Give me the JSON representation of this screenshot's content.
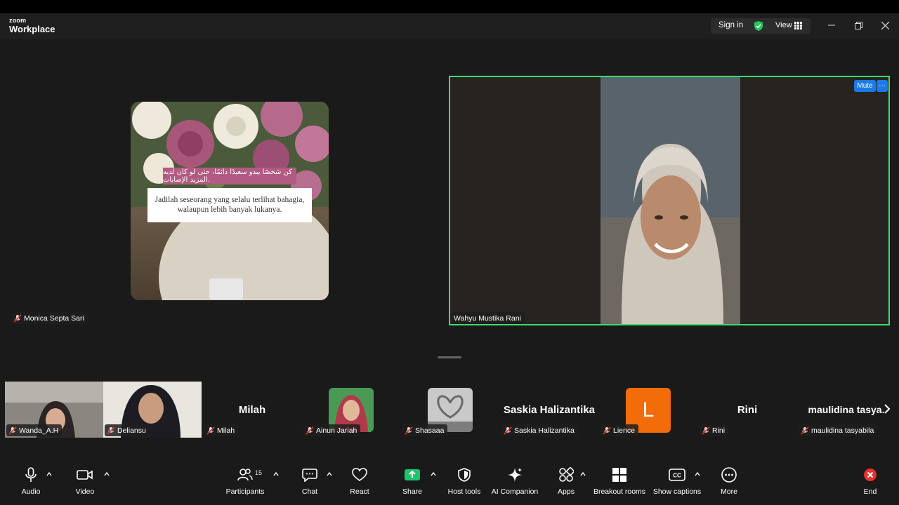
{
  "app": {
    "logo_top": "zoom",
    "logo_bottom": "Workplace"
  },
  "titlebar": {
    "sign_in": "Sign in",
    "view": "View"
  },
  "shared_tile": {
    "arabic_text": "كن شخصًا يبدو سعيدًا دائمًا، حتى لو كان لديه المزيد الإصابات.",
    "caption_line1": "Jadilah seseorang yang selalu terlihat bahagia,",
    "caption_line2": "walaupun lebih banyak lukanya.",
    "name": "Monica Septa Sari"
  },
  "speaker_tile": {
    "name": "Wahyu Mustika Rani",
    "mute_label": "Mute",
    "more_label": "···"
  },
  "participants_strip": [
    {
      "name": "Wanda_A.H",
      "big": ""
    },
    {
      "name": "Deliansu",
      "big": ""
    },
    {
      "name": "Milah",
      "big": "Milah"
    },
    {
      "name": "Ainun Jariah",
      "big": ""
    },
    {
      "name": "Shasaaa",
      "big": ""
    },
    {
      "name": "Saskia Halizantika",
      "big": "Saskia Halizantika"
    },
    {
      "name": "Lience",
      "big": "",
      "avatar_letter": "L",
      "avatar_color": "#f26d0a"
    },
    {
      "name": "Rini",
      "big": "Rini"
    },
    {
      "name": "maulidina tasyabila",
      "big": "maulidina  tasya."
    }
  ],
  "toolbar": {
    "audio": "Audio",
    "video": "Video",
    "participants": "Participants",
    "participants_count": "15",
    "chat": "Chat",
    "react": "React",
    "share": "Share",
    "host_tools": "Host tools",
    "ai_companion": "AI Companion",
    "apps": "Apps",
    "breakout_rooms": "Breakout rooms",
    "show_captions": "Show captions",
    "more": "More",
    "end": "End"
  },
  "colors": {
    "active_speaker_border": "#3ddc6c",
    "share_green": "#1fc46a",
    "end_red": "#e5322d",
    "mute_blue": "#1c7ae8"
  }
}
